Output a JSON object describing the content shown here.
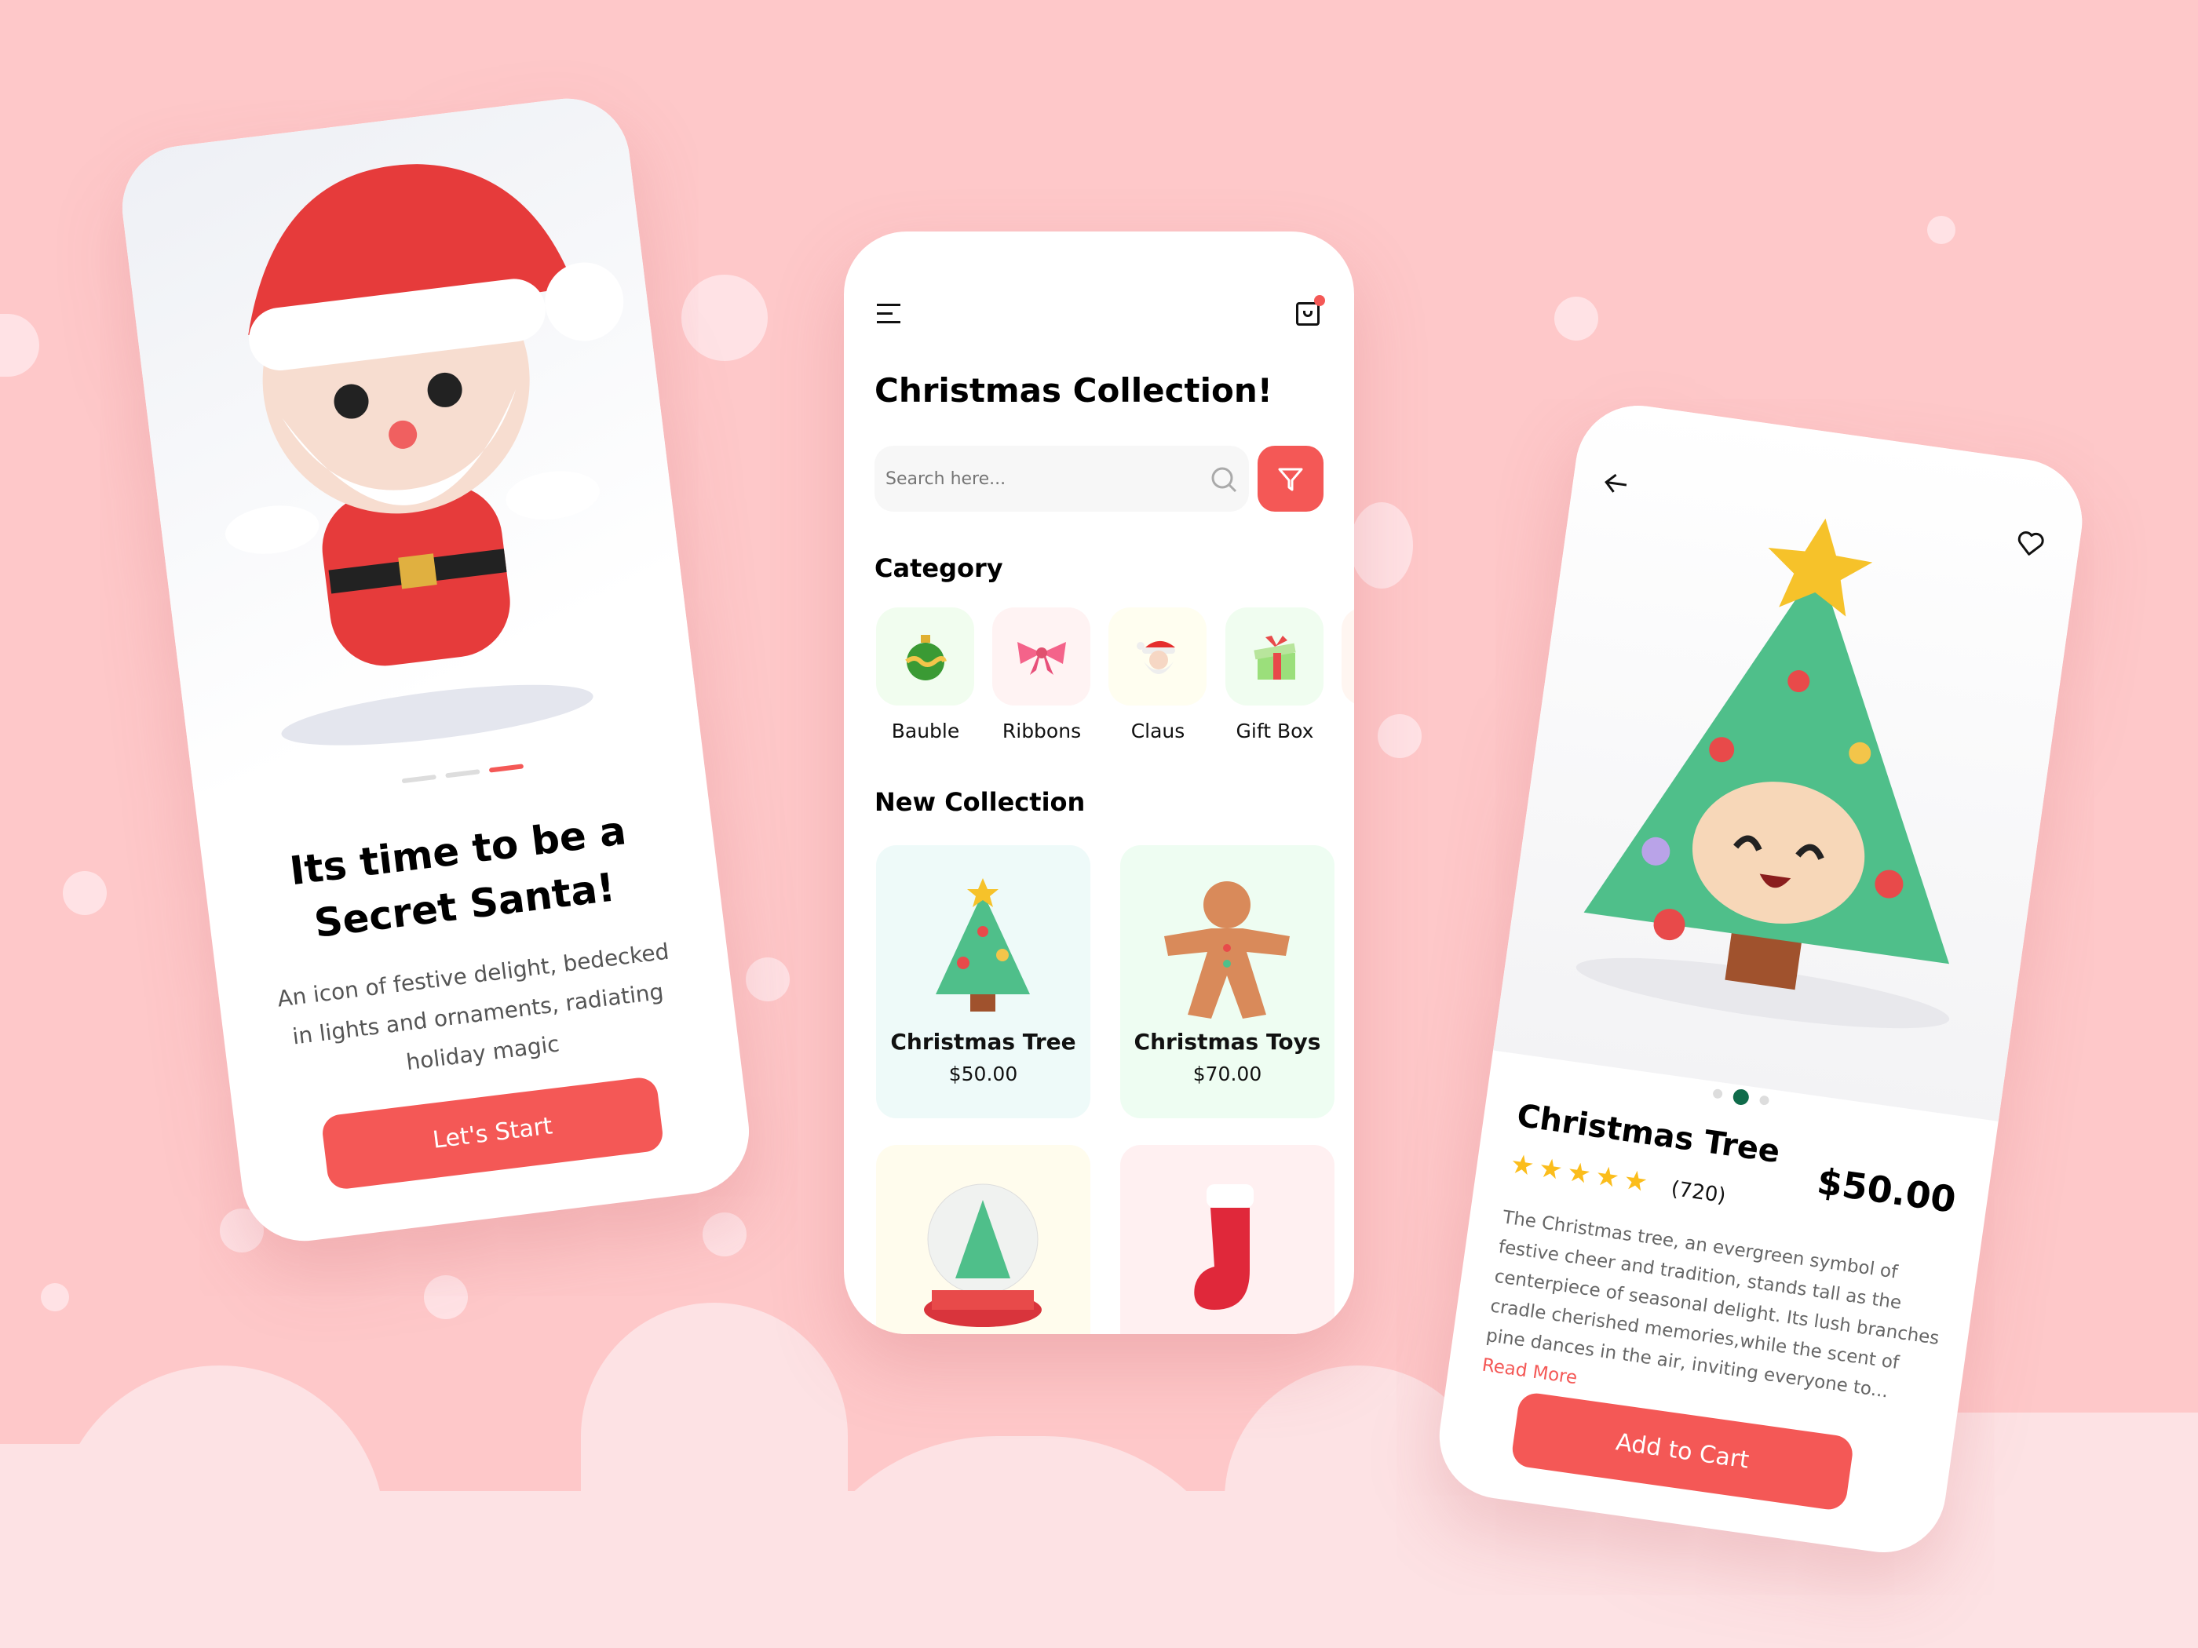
{
  "onboarding": {
    "title_line1": "Its time to be a",
    "title_line2": "Secret Santa!",
    "description": "An icon of festive delight, bedecked in lights and ornaments, radiating holiday  magic",
    "start_label": "Let's Start",
    "pager": {
      "count": 3,
      "active": 3
    }
  },
  "home": {
    "title": "Christmas Collection!",
    "search_placeholder": "Search here...",
    "category_heading": "Category",
    "categories": [
      {
        "label": "Bauble",
        "bg": "#f1fdef"
      },
      {
        "label": "Ribbons",
        "bg": "#fff3f3"
      },
      {
        "label": "Claus",
        "bg": "#fffef0"
      },
      {
        "label": "Gift Box",
        "bg": "#f0fdf0"
      }
    ],
    "new_collection_heading": "New Collection",
    "products": [
      {
        "name": "Christmas Tree",
        "price": "$50.00",
        "bg": "#eefaf9"
      },
      {
        "name": "Christmas Toys",
        "price": "$70.00",
        "bg": "#eefdf2"
      },
      {
        "name": "",
        "price": "",
        "bg": "#fffced"
      },
      {
        "name": "",
        "price": "",
        "bg": "#fff0f1"
      }
    ]
  },
  "detail": {
    "name": "Christmas Tree",
    "price": "$50.00",
    "rating": 5,
    "reviews": "(720)",
    "description": "The Christmas tree, an evergreen symbol of festive cheer and tradition, stands tall as the centerpiece of seasonal delight. Its lush branches cradle cherished memories,while the scent of pine dances in the air, inviting everyone to...",
    "read_more": "Read More",
    "add_to_cart": "Add to Cart",
    "pager": {
      "count": 3,
      "active": 2
    }
  },
  "colors": {
    "accent": "#f45856",
    "star": "#fbbd1c",
    "pager_active": "#0f6b4a",
    "background": "#fec8c9"
  }
}
